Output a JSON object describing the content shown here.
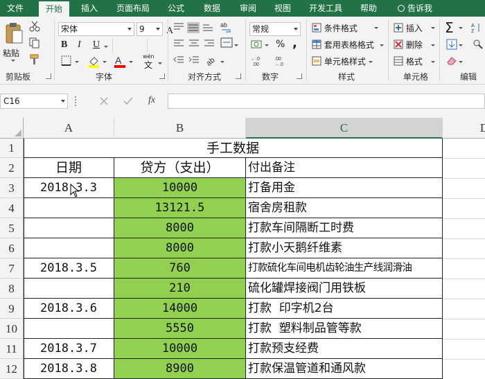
{
  "tabs": [
    {
      "label": "文件",
      "active": false
    },
    {
      "label": "开始",
      "active": true
    },
    {
      "label": "插入",
      "active": false
    },
    {
      "label": "页面布局",
      "active": false
    },
    {
      "label": "公式",
      "active": false
    },
    {
      "label": "数据",
      "active": false
    },
    {
      "label": "审阅",
      "active": false
    },
    {
      "label": "视图",
      "active": false
    },
    {
      "label": "开发工具",
      "active": false
    },
    {
      "label": "帮助",
      "active": false
    }
  ],
  "tell_me": "告诉我",
  "ribbon": {
    "clipboard": {
      "paste": "粘贴",
      "label": "剪贴板"
    },
    "font": {
      "name": "宋体",
      "size": "9",
      "label": "字体",
      "wen": "wén",
      "wen_char": "文"
    },
    "align": {
      "label": "对齐方式"
    },
    "number": {
      "format": "常规",
      "pct": "%",
      "comma": ",",
      "label": "数字"
    },
    "styles": {
      "cond": "条件格式",
      "table": "套用表格格式",
      "cell": "单元格样式",
      "label": "样式"
    },
    "cells": {
      "insert": "插入",
      "delete": "删除",
      "format": "格式",
      "label": "单元格"
    },
    "editing": {
      "label": "编辑"
    }
  },
  "formula_bar": {
    "name_box": "C16",
    "fx": "fx",
    "formula": ""
  },
  "colors": {
    "accent": "#217346",
    "fill_green": "#92d050",
    "font_red": "#ff0000",
    "highlight_yellow": "#ffff00"
  },
  "sheet": {
    "columns": [
      "A",
      "B",
      "C",
      "D"
    ],
    "selected_column": "C",
    "title": "手工数据",
    "headers": {
      "a": "日期",
      "b": "贷方（支出）",
      "c": "付出备注"
    },
    "rows": [
      {
        "num": "1"
      },
      {
        "num": "2"
      },
      {
        "num": "3",
        "a": "2018.3.3",
        "b": "10000",
        "c": "打备用金"
      },
      {
        "num": "4",
        "a": "",
        "b": "13121.5",
        "c": "宿舍房租款"
      },
      {
        "num": "5",
        "a": "",
        "b": "8000",
        "c": "打款车间隔断工时费"
      },
      {
        "num": "6",
        "a": "",
        "b": "8000",
        "c": "打款小天鹅纤维素"
      },
      {
        "num": "7",
        "a": "2018.3.5",
        "b": "760",
        "c": "打款硫化车间电机齿轮油生产线润滑油"
      },
      {
        "num": "8",
        "a": "",
        "b": "210",
        "c": "硫化罐焊接阀门用铁板"
      },
      {
        "num": "9",
        "a": "2018.3.6",
        "b": "14000",
        "c": "打款  印字机2台"
      },
      {
        "num": "10",
        "a": "",
        "b": "5550",
        "c": "打款  塑料制品管等款"
      },
      {
        "num": "11",
        "a": "2018.3.7",
        "b": "10000",
        "c": "打款预支经费"
      },
      {
        "num": "12",
        "a": "2018.3.8",
        "b": "8900",
        "c": "打款保温管道和通风款"
      }
    ]
  }
}
